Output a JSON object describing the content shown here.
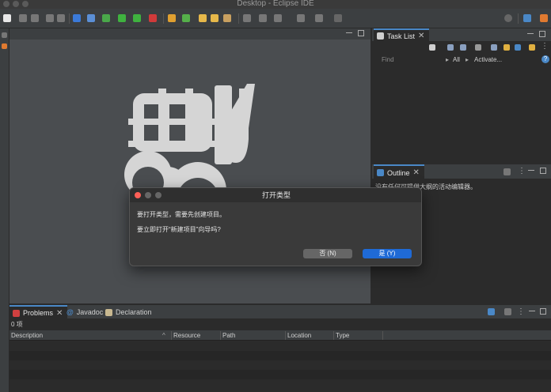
{
  "window": {
    "title": "Desktop - Eclipse IDE"
  },
  "task_list": {
    "tab_label": "Task List",
    "find_placeholder": "Find",
    "all_label": "All",
    "activate_label": "Activate..."
  },
  "outline": {
    "tab_label": "Outline",
    "message": "没有任何可提供大纲的活动编辑器。"
  },
  "dialog": {
    "title": "打开类型",
    "line1": "要打开类型，需要先创建项目。",
    "line2": "要立即打开“新建项目”向导吗?",
    "no_label": "否 (N)",
    "yes_label": "是 (Y)"
  },
  "bottom_panel": {
    "tabs": [
      "Problems",
      "Javadoc",
      "Declaration"
    ],
    "item_count": "0 项",
    "columns": [
      "Description",
      "Resource",
      "Path",
      "Location",
      "Type"
    ]
  },
  "colors": {
    "accent": "#4a88c7",
    "primary_button": "#1f6ad6",
    "close_dot": "#ff5f57"
  }
}
